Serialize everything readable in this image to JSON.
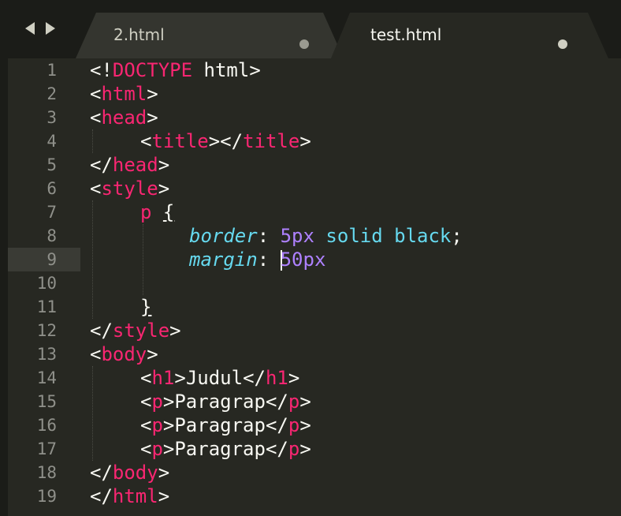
{
  "tabs": [
    {
      "label": "2.html",
      "active": false
    },
    {
      "label": "test.html",
      "active": true
    }
  ],
  "gutter": [
    "1",
    "2",
    "3",
    "4",
    "5",
    "6",
    "7",
    "8",
    "9",
    "10",
    "11",
    "12",
    "13",
    "14",
    "15",
    "16",
    "17",
    "18",
    "19"
  ],
  "code": {
    "l1": {
      "lt": "<",
      "bang": "!",
      "kw": "DOCTYPE",
      "rest": " html",
      "gt": ">"
    },
    "l2": {
      "lt": "<",
      "tag": "html",
      "gt": ">"
    },
    "l3": {
      "lt": "<",
      "tag": "head",
      "gt": ">"
    },
    "l4": {
      "lt1": "<",
      "tag1": "title",
      "gt1": ">",
      "lt2": "</",
      "tag2": "title",
      "gt2": ">"
    },
    "l5": {
      "lt": "</",
      "tag": "head",
      "gt": ">"
    },
    "l6": {
      "lt": "<",
      "tag": "style",
      "gt": ">"
    },
    "l7": {
      "sel": "p",
      "brace": "{"
    },
    "l8": {
      "prop": "border",
      "colon": ":",
      "num": "5px",
      "val": " solid black",
      "semi": ";"
    },
    "l9": {
      "prop": "margin",
      "colon": ":",
      "num": "50px"
    },
    "l11": {
      "brace": "}"
    },
    "l12": {
      "lt": "</",
      "tag": "style",
      "gt": ">"
    },
    "l13": {
      "lt": "<",
      "tag": "body",
      "gt": ">"
    },
    "l14": {
      "lt1": "<",
      "tag1": "h1",
      "gt1": ">",
      "text": "Judul",
      "lt2": "</",
      "tag2": "h1",
      "gt2": ">"
    },
    "l15": {
      "lt1": "<",
      "tag1": "p",
      "gt1": ">",
      "text": "Paragrap",
      "lt2": "</",
      "tag2": "p",
      "gt2": ">"
    },
    "l16": {
      "lt1": "<",
      "tag1": "p",
      "gt1": ">",
      "text": "Paragrap",
      "lt2": "</",
      "tag2": "p",
      "gt2": ">"
    },
    "l17": {
      "lt1": "<",
      "tag1": "p",
      "gt1": ">",
      "text": "Paragrap",
      "lt2": "</",
      "tag2": "p",
      "gt2": ">"
    },
    "l18": {
      "lt": "</",
      "tag": "body",
      "gt": ">"
    },
    "l19": {
      "lt": "</",
      "tag": "html",
      "gt": ">"
    }
  },
  "colors": {
    "background": "#272822",
    "tag": "#f92672",
    "property": "#66d9ef",
    "number": "#ae81ff",
    "text": "#f8f8f2"
  }
}
